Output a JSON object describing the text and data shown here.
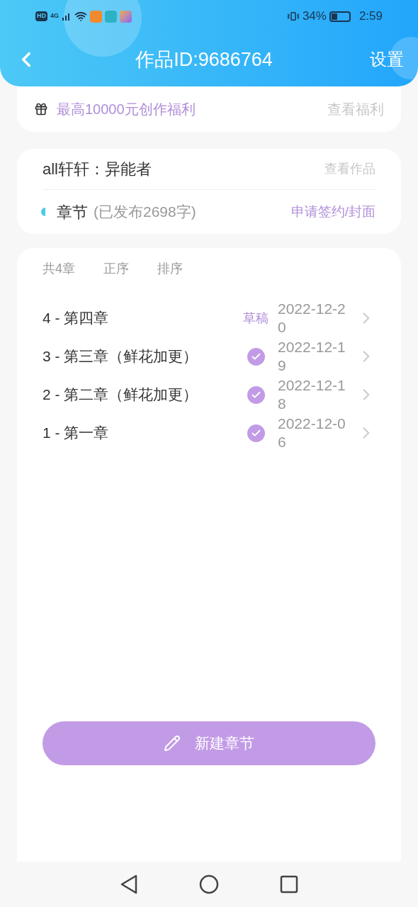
{
  "status_bar": {
    "left_badges": [
      "HD",
      "4G"
    ],
    "battery_text": "34%",
    "time": "2:59"
  },
  "header": {
    "title": "作品ID:9686764",
    "action": "设置"
  },
  "benefit": {
    "text": "最高10000元创作福利",
    "link": "查看福利"
  },
  "work": {
    "name": "all轩轩：异能者",
    "link": "查看作品",
    "section": "章节",
    "published": "(已发布2698字)",
    "apply": "申请签约/封面"
  },
  "toolbar": [
    "共4章",
    "正序",
    "排序"
  ],
  "chapters": [
    {
      "title": "4 - 第四章",
      "kind": "draft",
      "badge": "草稿",
      "date": "2022-12-20"
    },
    {
      "title": "3 - 第三章（鲜花加更）",
      "kind": "published",
      "date": "2022-12-19"
    },
    {
      "title": "2 - 第二章（鲜花加更）",
      "kind": "published",
      "date": "2022-12-18"
    },
    {
      "title": "1 - 第一章",
      "kind": "published",
      "date": "2022-12-06"
    }
  ],
  "new_button": "新建章节"
}
